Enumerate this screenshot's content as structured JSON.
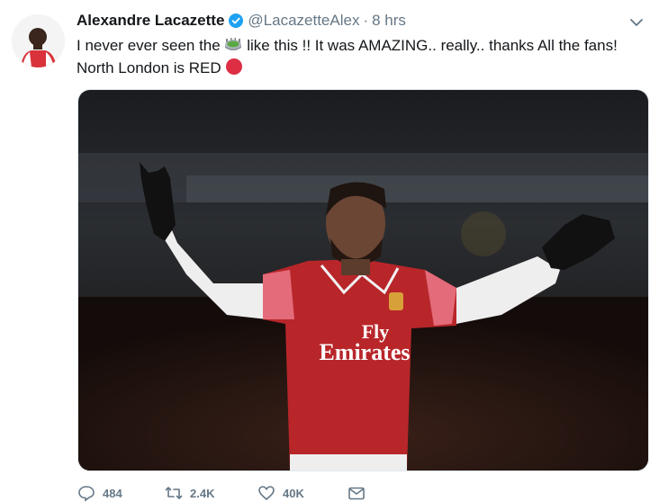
{
  "tweet": {
    "author_name": "Alexandre Lacazette",
    "handle": "@LacazetteAlex",
    "separator": "·",
    "time": "8 hrs",
    "text_part1": "I never ever seen the",
    "text_part2": "like this !! It was AMAZING.. really.. thanks All the fans!",
    "text_part3": "North London is RED",
    "media_shirt_text_line1": "Fly",
    "media_shirt_text_line2": "Emirates",
    "icons": {
      "verified": "verified-badge-icon",
      "chevron": "chevron-down-icon",
      "stadium": "stadium-emoji",
      "red_circle": "red-circle-emoji"
    }
  },
  "actions": {
    "reply_count": "484",
    "retweet_count": "2.4K",
    "like_count": "40K"
  },
  "colors": {
    "accent": "#1da1f2",
    "muted": "#657786",
    "text": "#14171a",
    "arsenal_red": "#c8102e"
  }
}
